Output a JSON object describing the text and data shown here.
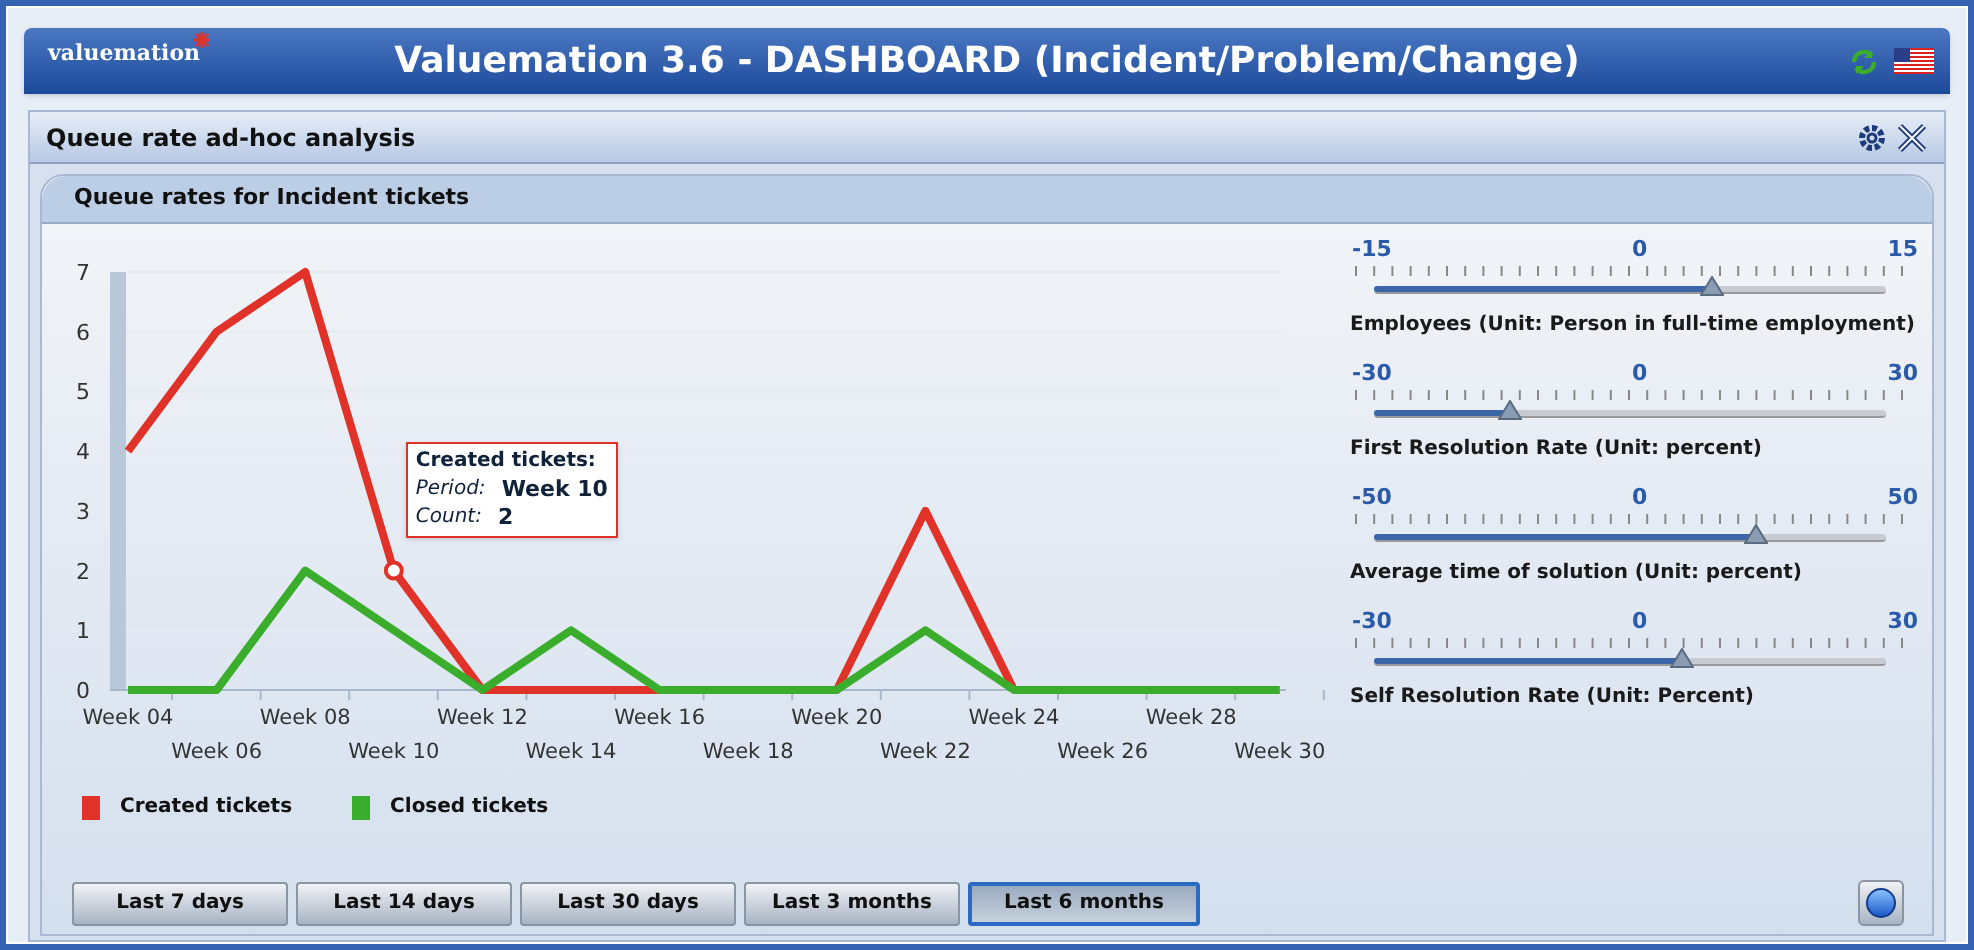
{
  "header": {
    "logo": "valuemation",
    "title": "Valuemation 3.6 - DASHBOARD (Incident/Problem/Change)"
  },
  "panel": {
    "title": "Queue rate ad-hoc analysis"
  },
  "card": {
    "title": "Queue rates for Incident tickets",
    "chart_data": {
      "type": "line",
      "categories": [
        "Week 04",
        "Week 06",
        "Week 08",
        "Week 10",
        "Week 12",
        "Week 14",
        "Week 16",
        "Week 18",
        "Week 20",
        "Week 22",
        "Week 24",
        "Week 26",
        "Week 28",
        "Week 30"
      ],
      "ylim": [
        0,
        7
      ],
      "yticks": [
        0,
        1,
        2,
        3,
        4,
        5,
        6,
        7
      ],
      "series": [
        {
          "name": "Created tickets",
          "color": "#e03228",
          "values": [
            4,
            6,
            7,
            2,
            0,
            0,
            0,
            0,
            0,
            3,
            0,
            null,
            null,
            null
          ]
        },
        {
          "name": "Closed tickets",
          "color": "#3aae2c",
          "values": [
            0,
            0,
            2,
            1,
            0,
            1,
            0,
            0,
            0,
            1,
            0,
            0,
            0,
            0
          ]
        }
      ]
    },
    "tooltip": {
      "title": "Created tickets:",
      "rows": [
        {
          "label": "Period:",
          "value": "Week 10"
        },
        {
          "label": "Count:",
          "value": "2"
        }
      ]
    },
    "sliders": [
      {
        "min": "-15",
        "mid": "0",
        "max": "15",
        "level": 0.66,
        "label": "Employees (Unit: Person in full-time employment)"
      },
      {
        "min": "-30",
        "mid": "0",
        "max": "30",
        "level": 0.265,
        "label": "First Resolution Rate (Unit: percent)"
      },
      {
        "min": "-50",
        "mid": "0",
        "max": "50",
        "level": 0.745,
        "label": "Average time of solution (Unit: percent)"
      },
      {
        "min": "-30",
        "mid": "0",
        "max": "30",
        "level": 0.6,
        "label": "Self Resolution Rate (Unit: Percent)"
      }
    ],
    "ranges": [
      {
        "label": "Last 7 days",
        "selected": false
      },
      {
        "label": "Last 14 days",
        "selected": false
      },
      {
        "label": "Last 30 days",
        "selected": false
      },
      {
        "label": "Last 3 months",
        "selected": false
      },
      {
        "label": "Last 6 months",
        "selected": true
      }
    ]
  }
}
